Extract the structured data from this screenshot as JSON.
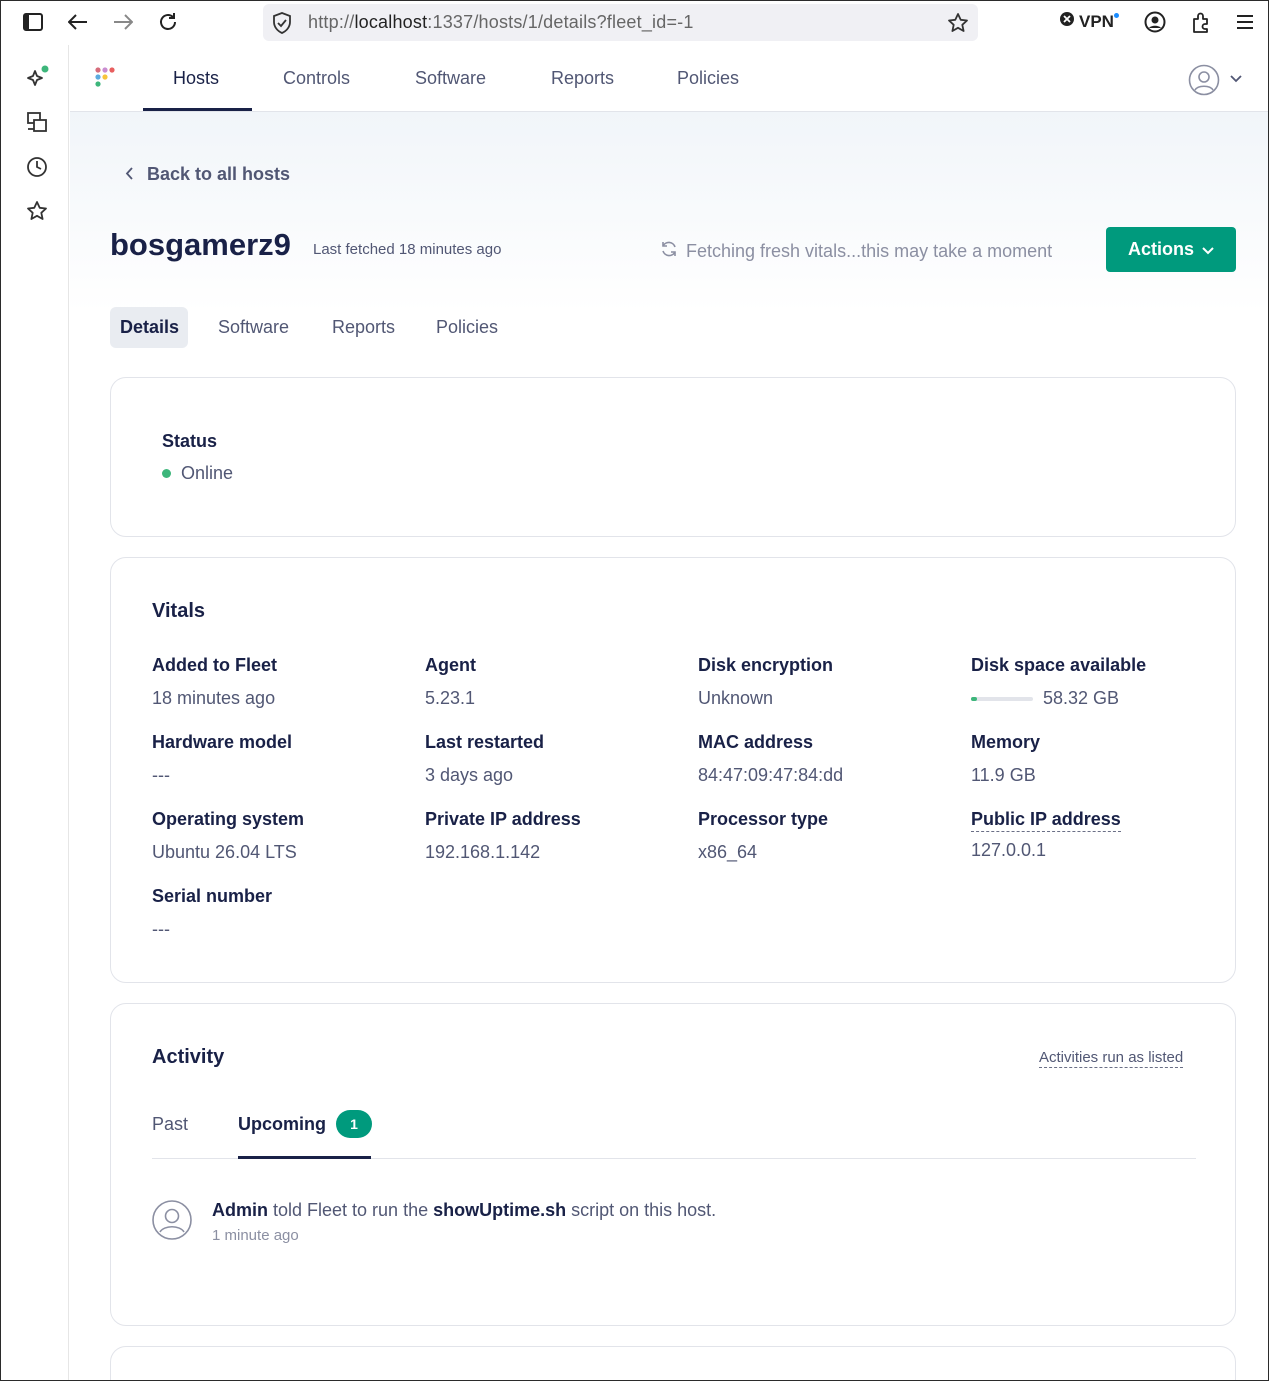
{
  "browser": {
    "url_prefix": "http://",
    "url_host": "localhost",
    "url_rest": ":1337/hosts/1/details?fleet_id=-1",
    "vpn_label": "VPN"
  },
  "nav": {
    "items": [
      "Hosts",
      "Controls",
      "Software",
      "Reports",
      "Policies"
    ],
    "active": "Hosts"
  },
  "host": {
    "back_label": "Back to all hosts",
    "name": "bosgamerz9",
    "last_fetched": "Last fetched 18 minutes ago",
    "fetching": "Fetching fresh vitals...this may take a moment",
    "actions_label": "Actions"
  },
  "tabs": [
    "Details",
    "Software",
    "Reports",
    "Policies"
  ],
  "status": {
    "label": "Status",
    "value": "Online",
    "color": "#3db67b"
  },
  "vitals": {
    "title": "Vitals",
    "added_to_fleet": {
      "label": "Added to Fleet",
      "value": "18 minutes ago"
    },
    "agent": {
      "label": "Agent",
      "value": "5.23.1"
    },
    "disk_encryption": {
      "label": "Disk encryption",
      "value": "Unknown"
    },
    "disk_space": {
      "label": "Disk space available",
      "value": "58.32 GB",
      "fill_fraction": 0.1
    },
    "hardware_model": {
      "label": "Hardware model",
      "value": "---"
    },
    "last_restarted": {
      "label": "Last restarted",
      "value": "3 days ago"
    },
    "mac_address": {
      "label": "MAC address",
      "value": "84:47:09:47:84:dd"
    },
    "memory": {
      "label": "Memory",
      "value": "11.9 GB"
    },
    "operating_system": {
      "label": "Operating system",
      "value": "Ubuntu 26.04 LTS"
    },
    "private_ip": {
      "label": "Private IP address",
      "value": "192.168.1.142"
    },
    "processor_type": {
      "label": "Processor type",
      "value": "x86_64"
    },
    "public_ip": {
      "label": "Public IP address",
      "value": "127.0.0.1"
    },
    "serial_number": {
      "label": "Serial number",
      "value": "---"
    }
  },
  "activity": {
    "title": "Activity",
    "note": "Activities run as listed",
    "tab_past": "Past",
    "tab_upcoming": "Upcoming",
    "upcoming_count": "1",
    "item": {
      "actor": "Admin",
      "text_before": " told Fleet to run the ",
      "script": "showUptime.sh",
      "text_after": " script on this host.",
      "time": "1 minute ago"
    }
  },
  "colors": {
    "accent": "#009a7d",
    "text": "#192147",
    "muted": "#515774"
  }
}
